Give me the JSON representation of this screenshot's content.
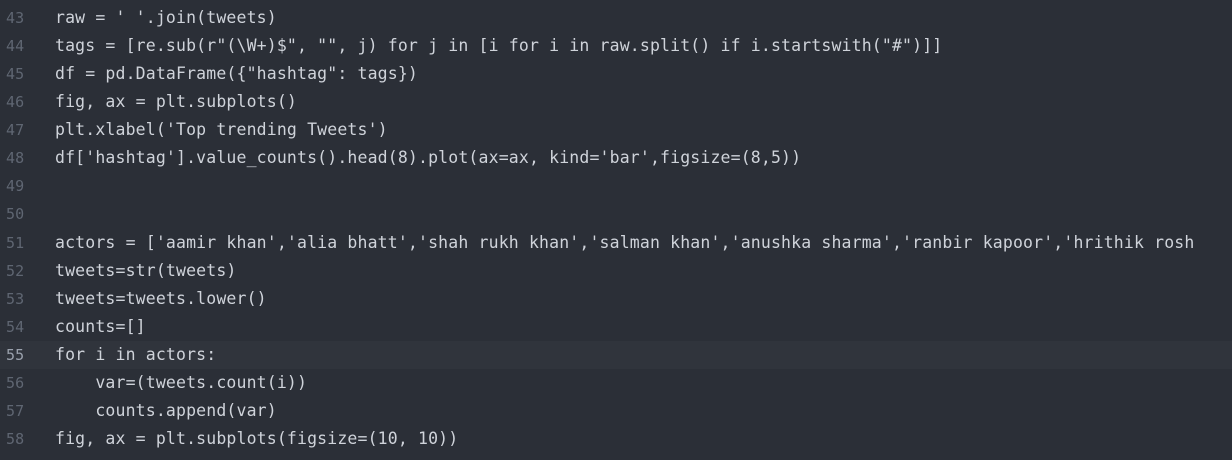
{
  "editor": {
    "active_line": 55,
    "lines": [
      {
        "num": "43",
        "text": "raw = ' '.join(tweets)"
      },
      {
        "num": "44",
        "text": "tags = [re.sub(r\"(\\W+)$\", \"\", j) for j in [i for i in raw.split() if i.startswith(\"#\")]]"
      },
      {
        "num": "45",
        "text": "df = pd.DataFrame({\"hashtag\": tags})"
      },
      {
        "num": "46",
        "text": "fig, ax = plt.subplots()"
      },
      {
        "num": "47",
        "text": "plt.xlabel('Top trending Tweets')"
      },
      {
        "num": "48",
        "text": "df['hashtag'].value_counts().head(8).plot(ax=ax, kind='bar',figsize=(8,5))"
      },
      {
        "num": "49",
        "text": ""
      },
      {
        "num": "50",
        "text": ""
      },
      {
        "num": "51",
        "text": "actors = ['aamir khan','alia bhatt','shah rukh khan','salman khan','anushka sharma','ranbir kapoor','hrithik rosh"
      },
      {
        "num": "52",
        "text": "tweets=str(tweets)"
      },
      {
        "num": "53",
        "text": "tweets=tweets.lower()"
      },
      {
        "num": "54",
        "text": "counts=[]"
      },
      {
        "num": "55",
        "text": "for i in actors:"
      },
      {
        "num": "56",
        "text": "    var=(tweets.count(i))"
      },
      {
        "num": "57",
        "text": "    counts.append(var)"
      },
      {
        "num": "58",
        "text": "fig, ax = plt.subplots(figsize=(10, 10))"
      }
    ]
  }
}
